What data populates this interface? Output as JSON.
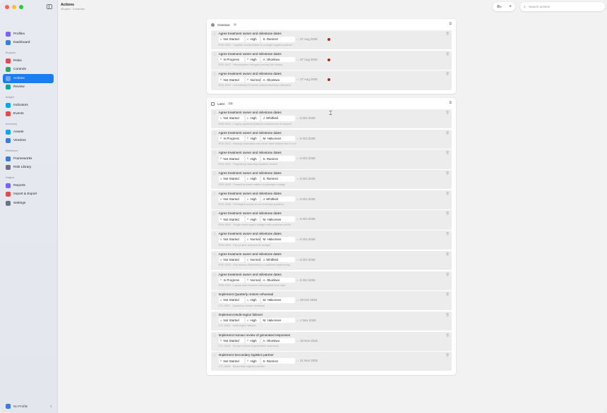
{
  "window": {
    "title": "Actions",
    "subtitle": "18 open · 3 overdue"
  },
  "sidebar": {
    "sections": [
      {
        "label": "",
        "items": [
          {
            "label": "Profiles",
            "icon": "profiles-icon",
            "color": "#7b61ff"
          },
          {
            "label": "Dashboard",
            "icon": "dashboard-icon",
            "color": "#3a7be0"
          }
        ]
      },
      {
        "label": "Register",
        "items": [
          {
            "label": "Risks",
            "icon": "risks-icon",
            "color": "#e5484d"
          },
          {
            "label": "Controls",
            "icon": "controls-icon",
            "color": "#30a46c"
          },
          {
            "label": "Actions",
            "icon": "actions-icon",
            "color": "#3a7be0",
            "active": true
          },
          {
            "label": "Review",
            "icon": "review-icon",
            "color": "#12a594"
          }
        ]
      },
      {
        "label": "Insight",
        "items": [
          {
            "label": "Indicators",
            "icon": "indicators-icon",
            "color": "#0ea5e9"
          },
          {
            "label": "Events",
            "icon": "events-icon",
            "color": "#e5484d"
          }
        ]
      },
      {
        "label": "Inventory",
        "items": [
          {
            "label": "Assets",
            "icon": "assets-icon",
            "color": "#0ea5e9"
          },
          {
            "label": "Vendors",
            "icon": "vendors-icon",
            "color": "#3a7be0"
          }
        ]
      },
      {
        "label": "Reference",
        "items": [
          {
            "label": "Frameworks",
            "icon": "frameworks-icon",
            "color": "#3a7be0"
          },
          {
            "label": "Risk Library",
            "icon": "risk-library-icon",
            "color": "#6b7280"
          }
        ]
      },
      {
        "label": "Output",
        "items": [
          {
            "label": "Reports",
            "icon": "reports-icon",
            "color": "#7b61ff"
          },
          {
            "label": "Import & Export",
            "icon": "import-export-icon",
            "color": "#e5484d"
          },
          {
            "label": "Settings",
            "icon": "settings-icon",
            "color": "#6b7280"
          }
        ]
      }
    ],
    "profile": {
      "label": "No Profile"
    }
  },
  "toolbar": {
    "filter_icon": "filter-icon",
    "add_icon": "plus-icon",
    "search_placeholder": "Search actions"
  },
  "groups": [
    {
      "title": "Overdue",
      "count": "3",
      "icon": "alert-icon",
      "rows": [
        {
          "title": "Agree treatment owner and milestone dates",
          "status": "Not Started",
          "priority": "High",
          "owner": "S. Ramirez",
          "date": "27 Aug 2026",
          "overdue": true,
          "code": "RSK-0013 · Supplier concentration in a single logistics partner"
        },
        {
          "title": "Agree treatment owner and milestone dates",
          "status": "In Progress",
          "priority": "High",
          "owner": "A. Okonkwo",
          "date": "27 Aug 2026",
          "overdue": true,
          "code": "RSK-0007 · Ransomware encrypts primary file shares"
        },
        {
          "title": "Agree treatment owner and milestone dates",
          "status": "Not Started",
          "priority": "Normal",
          "owner": "A. Okonkwo",
          "date": "27 Aug 2026",
          "overdue": true,
          "code": "RSK-0019 · Unreviewed AI model output reaching customers"
        }
      ]
    },
    {
      "title": "Later",
      "count": "15",
      "icon": "calendar-icon",
      "rows": [
        {
          "title": "Agree treatment owner and milestone dates",
          "status": "Not Started",
          "priority": "High",
          "owner": "J. Whitfield",
          "date": "5 Oct 2026",
          "code": "RSK-0012 · Legacy payment platform reaches end of support"
        },
        {
          "title": "Agree treatment owner and milestone dates",
          "status": "In Progress",
          "priority": "High",
          "owner": "M. Halvorsen",
          "date": "5 Oct 2026",
          "code": "RSK-0001 · Backup restoration has never been tested end to end"
        },
        {
          "title": "Agree treatment owner and milestone dates",
          "status": "Not Started",
          "priority": "High",
          "owner": "S. Ramirez",
          "date": "5 Oct 2026",
          "code": "RSK-0015 · Regulatory reporting deadline missed"
        },
        {
          "title": "Agree treatment owner and milestone dates",
          "status": "Not Started",
          "priority": "High",
          "owner": "S. Ramirez",
          "date": "5 Oct 2026",
          "code": "RSK-0009 · Phased provider suffers a prolonged outage"
        },
        {
          "title": "Agree treatment owner and milestone dates",
          "status": "Not Started",
          "priority": "High",
          "owner": "J. Whitfield",
          "date": "5 Oct 2026",
          "code": "RSK-0008 · Privileged access is not reviewed quarterly"
        },
        {
          "title": "Agree treatment owner and milestone dates",
          "status": "Not Started",
          "priority": "High",
          "owner": "M. Halvorsen",
          "date": "5 Oct 2026",
          "code": "RSK-0003 · Single cloud region outage halts customer portal"
        },
        {
          "title": "Agree treatment owner and milestone dates",
          "status": "Not Started",
          "priority": "Normal",
          "owner": "M. Halvorsen",
          "date": "5 Oct 2026",
          "code": "RSK-0016 · Key project overruns its budget"
        },
        {
          "title": "Agree treatment owner and milestone dates",
          "status": "Not Started",
          "priority": "Normal",
          "owner": "J. Whitfield",
          "date": "5 Oct 2026",
          "code": "RSK-0004 · Key person dependency in platform engineering"
        },
        {
          "title": "Agree treatment owner and milestone dates",
          "status": "In Progress",
          "priority": "Normal",
          "owner": "A. Okonkwo",
          "date": "5 Oct 2026",
          "code": "RSK-0010 · Laptop loss exposes unencrypted local data"
        },
        {
          "title": "Implement Quarterly restore rehearsal",
          "status": "Not Started",
          "priority": "High",
          "owner": "M. Halvorsen",
          "date": "29 Oct 2026",
          "code": "CTL-0001 · Quarterly restore rehearsal"
        },
        {
          "title": "Implement Multi-region failover",
          "status": "Not Started",
          "priority": "High",
          "owner": "M. Halvorsen",
          "date": "1 Nov 2026",
          "code": "CTL-0004 · Multi-region failover"
        },
        {
          "title": "Implement Human review of generated responses",
          "status": "Not Started",
          "priority": "High",
          "owner": "A. Okonkwo",
          "date": "19 Nov 2026",
          "code": "CTL-0015 · Human review of generated responses"
        },
        {
          "title": "Implement Secondary logistics partner",
          "status": "Not Started",
          "priority": "High",
          "owner": "S. Ramirez",
          "date": "21 Nov 2026",
          "code": "CTL-0008 · Secondary logistics partner"
        }
      ]
    }
  ]
}
